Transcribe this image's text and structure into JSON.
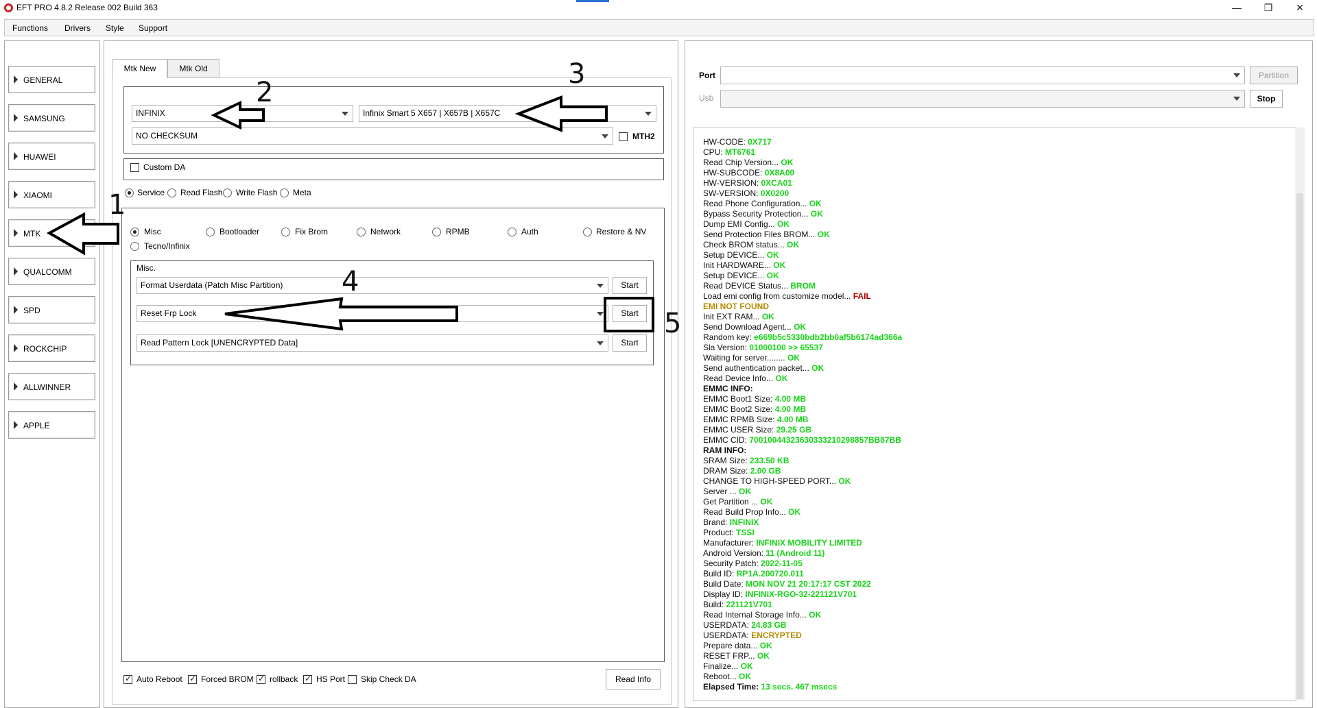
{
  "window": {
    "title": "EFT PRO 4.8.2 Release 002 Build 363",
    "controls": [
      "—",
      "❐",
      "✕"
    ]
  },
  "menu": [
    "Functions",
    "Drivers",
    "Style",
    "Support"
  ],
  "categories": [
    "GENERAL",
    "SAMSUNG",
    "HUAWEI",
    "XIAOMI",
    "MTK",
    "QUALCOMM",
    "SPD",
    "ROCKCHIP",
    "ALLWINNER",
    "APPLE"
  ],
  "tabs": [
    "Mtk New",
    "Mtk Old"
  ],
  "device": {
    "brand": "INFINIX",
    "model": "Infinix Smart 5   X657 | X657B | X657C",
    "checksum": "NO CHECKSUM",
    "mth2_label": "MTH2",
    "custom_da_label": "Custom DA"
  },
  "modes": [
    "Service",
    "Read Flash",
    "Write Flash",
    "Meta"
  ],
  "service_tabs": [
    "Misc",
    "Bootloader",
    "Fix Brom",
    "Network",
    "RPMB",
    "Auth",
    "Restore & NV",
    "Tecno/Infinix"
  ],
  "misc": {
    "title": "Misc.",
    "rows": [
      {
        "op": "Format Userdata (Patch Misc Partition)",
        "button": "Start"
      },
      {
        "op": "Reset Frp Lock",
        "button": "Start"
      },
      {
        "op": "Read Pattern Lock [UNENCRYPTED Data]",
        "button": "Start"
      }
    ]
  },
  "options": [
    "Auto Reboot",
    "Forced BROM",
    "rollback",
    "HS Port",
    "Skip Check DA"
  ],
  "read_info_label": "Read Info",
  "port": {
    "label": "Port",
    "usb_label": "Usb",
    "partition_label": "Partition",
    "stop_label": "Stop"
  },
  "annotations": [
    "1",
    "2",
    "3",
    "4",
    "5"
  ],
  "log": [
    {
      "t": "HW-CODE: ",
      "v": "0X717"
    },
    {
      "t": "CPU: ",
      "v": "MT6761"
    },
    {
      "t": "Read Chip Version... ",
      "v": "OK"
    },
    {
      "t": "HW-SUBCODE: ",
      "v": "0X8A00"
    },
    {
      "t": "HW-VERSION: ",
      "v": "0XCA01"
    },
    {
      "t": "SW-VERSION: ",
      "v": "0X0200"
    },
    {
      "t": "Read Phone Configuration... ",
      "v": "OK"
    },
    {
      "t": "Bypass Security Protection... ",
      "v": "OK"
    },
    {
      "t": "Dump EMI Config... ",
      "v": "OK"
    },
    {
      "t": "Send Protection Files BROM... ",
      "v": "OK"
    },
    {
      "t": "Check BROM status... ",
      "v": "OK"
    },
    {
      "t": "Setup DEVICE... ",
      "v": "OK"
    },
    {
      "t": "Init HARDWARE... ",
      "v": "OK"
    },
    {
      "t": "Setup DEVICE... ",
      "v": "OK"
    },
    {
      "t": "Read DEVICE Status... ",
      "v": "BROM"
    },
    {
      "t": "Load emi config from customize model... ",
      "v": "FAIL",
      "c": "fail"
    },
    {
      "t": "  ",
      "v": "EMI NOT FOUND",
      "c": "warn"
    },
    {
      "t": "Init EXT RAM... ",
      "v": "OK"
    },
    {
      "t": "Send Download Agent... ",
      "v": "OK"
    },
    {
      "t": "Random key:  ",
      "v": "e669b5c5330bdb2bb0af5b6174ad366a"
    },
    {
      "t": "Sla Version:  ",
      "v": "01000100  >> 65537"
    },
    {
      "t": "Waiting for server........ ",
      "v": "OK"
    },
    {
      "t": "Send authentication packet... ",
      "v": "OK"
    },
    {
      "t": "Read Device Info... ",
      "v": "OK"
    },
    {
      "t": "EMMC INFO:",
      "v": "",
      "b": true
    },
    {
      "t": "EMMC Boot1 Size: ",
      "v": "4.00 MB"
    },
    {
      "t": "EMMC Boot2 Size: ",
      "v": "4.00 MB"
    },
    {
      "t": "EMMC RPMB Size: ",
      "v": "4.00 MB"
    },
    {
      "t": "EMMC USER Size: ",
      "v": "29.25 GB"
    },
    {
      "t": "EMMC CID: ",
      "v": "70010044323630333210298857BB87BB"
    },
    {
      "t": "RAM INFO:",
      "v": "",
      "b": true
    },
    {
      "t": "SRAM Size: ",
      "v": "233.50 KB"
    },
    {
      "t": "DRAM Size: ",
      "v": "2.00 GB"
    },
    {
      "t": "CHANGE TO HIGH-SPEED PORT... ",
      "v": "OK"
    },
    {
      "t": "Server ... ",
      "v": "OK"
    },
    {
      "t": "Get Partition ... ",
      "v": "OK"
    },
    {
      "t": "Read Build Prop Info... ",
      "v": "OK"
    },
    {
      "t": " Brand: ",
      "v": "INFINIX"
    },
    {
      "t": " Product: ",
      "v": "TSSI"
    },
    {
      "t": " Manufacturer: ",
      "v": "INFINIX MOBILITY LIMITED"
    },
    {
      "t": " Android Version: ",
      "v": "11 (Android 11)"
    },
    {
      "t": " Security Patch: ",
      "v": "2022-11-05"
    },
    {
      "t": " Build ID: ",
      "v": "RP1A.200720.011"
    },
    {
      "t": " Build Date: ",
      "v": "MON NOV 21 20:17:17 CST 2022"
    },
    {
      "t": " Display ID: ",
      "v": "INFINIX-RGO-32-221121V701"
    },
    {
      "t": " Build: ",
      "v": "221121V701"
    },
    {
      "t": "Read Internal Storage Info... ",
      "v": "OK"
    },
    {
      "t": "USERDATA: ",
      "v": "24.83 GB"
    },
    {
      "t": "USERDATA: ",
      "v": "ENCRYPTED",
      "c": "warn"
    },
    {
      "t": "Prepare data... ",
      "v": "OK"
    },
    {
      "t": "RESET FRP... ",
      "v": "OK"
    },
    {
      "t": "Finalize... ",
      "v": "OK"
    },
    {
      "t": "Reboot... ",
      "v": "OK"
    },
    {
      "t": "Elapsed Time: ",
      "v": "13 secs. 467 msecs",
      "tb": true
    }
  ]
}
